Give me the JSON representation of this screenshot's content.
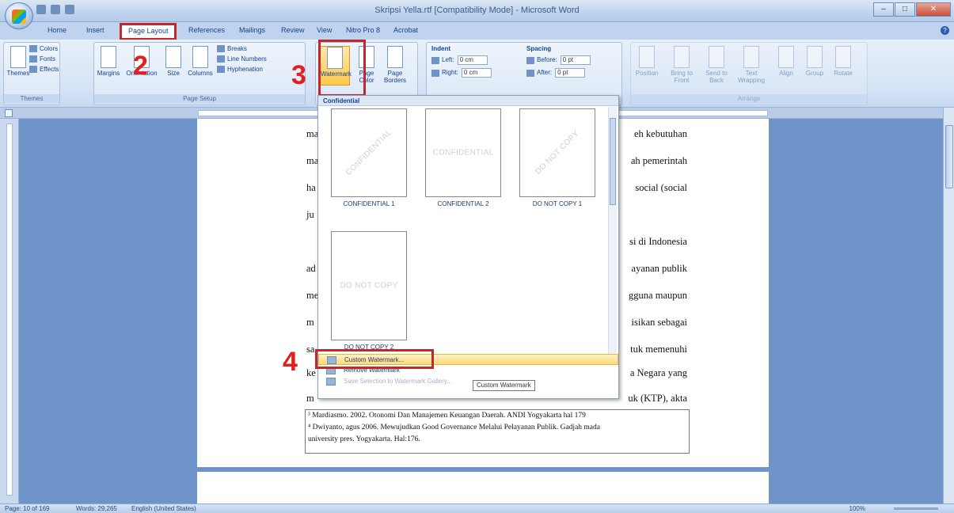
{
  "window": {
    "title": "Skripsi Yella.rtf [Compatibility Mode] - Microsoft Word",
    "controls": [
      "–",
      "□",
      "✕"
    ]
  },
  "tabs": [
    "Home",
    "Insert",
    "Page Layout",
    "References",
    "Mailings",
    "Review",
    "View",
    "Nitro Pro 8",
    "Acrobat"
  ],
  "ribbon": {
    "themes_group": {
      "label": "Themes",
      "themes": "Themes",
      "colors": "Colors",
      "fonts": "Fonts",
      "effects": "Effects"
    },
    "page_setup_group": {
      "label": "Page Setup",
      "margins": "Margins",
      "orientation": "Orientation",
      "size": "Size",
      "columns": "Columns",
      "breaks": "Breaks",
      "line_numbers": "Line Numbers",
      "hyphenation": "Hyphenation"
    },
    "page_background": {
      "watermark": "Watermark",
      "page_color": "Page Color",
      "page_borders": "Page Borders"
    },
    "paragraph_group": {
      "indent_label": "Indent",
      "left_label": "Left:",
      "left_value": "0 cm",
      "right_label": "Right:",
      "right_value": "0 cm",
      "spacing_label": "Spacing",
      "before_label": "Before:",
      "before_value": "0 pt",
      "after_label": "After:",
      "after_value": "0 pt"
    },
    "arrange_group": {
      "label": "Arrange",
      "position": "Position",
      "bring_to_front": "Bring to Front",
      "send_to_back": "Send to Back",
      "text_wrapping": "Text Wrapping",
      "align": "Align",
      "group": "Group",
      "rotate": "Rotate"
    }
  },
  "steps": {
    "two": "2",
    "three": "3",
    "four": "4"
  },
  "document": {
    "lines": [
      {
        "left": "ma",
        "right": "eh kebutuhan"
      },
      {
        "left": "ma",
        "right": "ah pemerintah"
      },
      {
        "left": "ha",
        "right": "social (social"
      },
      {
        "left": "ju",
        "right": ""
      },
      {
        "left": "",
        "right": "si di Indonesia"
      },
      {
        "left": "ad",
        "right": "ayanan publik"
      },
      {
        "left": "me",
        "right": "gguna maupun"
      },
      {
        "left": "m",
        "right": "isikan sebagai"
      },
      {
        "left": "sa",
        "right": "tuk memenuhi"
      },
      {
        "left": "ke",
        "right": "a Negara yang"
      },
      {
        "left": "m",
        "right": "uk (KTP), akta"
      }
    ],
    "footnotes": [
      "³ Mardiasmo. 2002. Otonomi Dan Manajemen Keuangan Daerah. ANDI Yogyakarta hal 179",
      "⁴ Dwiyanto, agus 2006. Mewujudkan Good Governance Melalui Pelayanan Publik. Gadjah mada",
      "university pres. Yogyakarta. Hal:176."
    ]
  },
  "watermark_menu": {
    "header": "Confidential",
    "items": [
      {
        "caption": "CONFIDENTIAL 1",
        "text": "CONFIDENTIAL"
      },
      {
        "caption": "CONFIDENTIAL 2",
        "text": "CONFIDENTIAL"
      },
      {
        "caption": "DO NOT COPY 1",
        "text": "DO NOT COPY"
      },
      {
        "caption": "DO NOT COPY 2",
        "text": "DO NOT COPY"
      }
    ],
    "custom": "Custom Watermark...",
    "remove": "Remove Watermark",
    "save": "Save Selection to Watermark Gallery...",
    "tooltip": "Custom Watermark"
  },
  "status": {
    "page": "Page: 10 of 169",
    "words": "Words: 29,265",
    "language": "English (United States)",
    "zoom": "100%"
  },
  "colors": {
    "accent": "#15428b",
    "callout": "#c0282c",
    "step": "#e02020",
    "hover": "#ffd97a"
  }
}
